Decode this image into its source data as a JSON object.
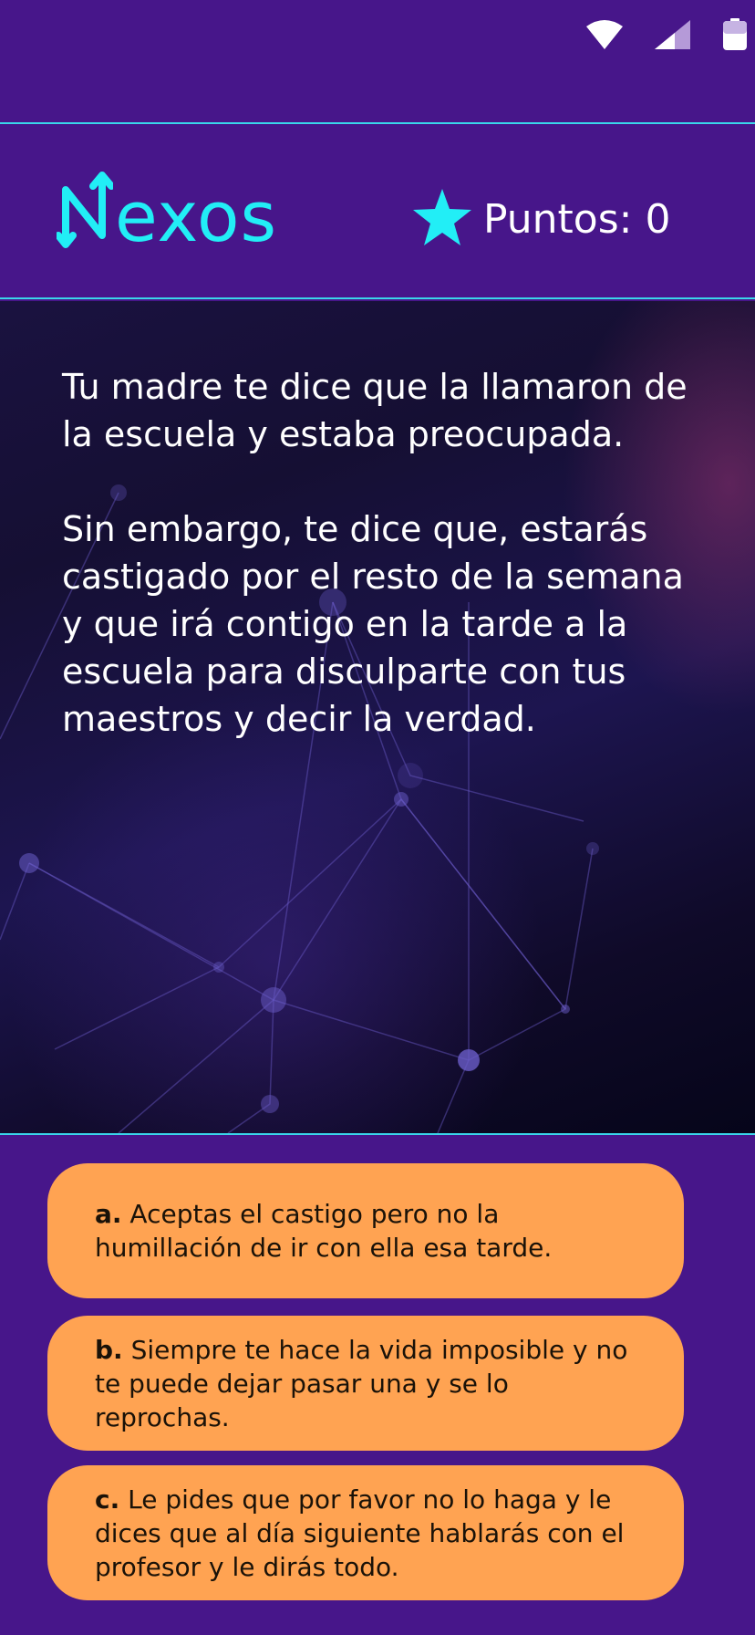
{
  "status_bar": {
    "icons": [
      "wifi-icon",
      "cell-signal-icon",
      "battery-icon"
    ]
  },
  "header": {
    "logo_text": "exos",
    "logo_letter": "N",
    "score_label": "Puntos: 0",
    "score_icon": "star-icon"
  },
  "story": {
    "paragraphs": [
      "Tu madre te dice que la llamaron de la escuela y estaba preocupada.",
      "Sin embargo, te dice que, estarás castigado por el resto de la semana y que irá contigo en la tarde a la escuela para disculparte con tus maestros y decir la verdad."
    ]
  },
  "options": [
    {
      "letter": "a.",
      "text": " Aceptas el castigo pero no la humillación de ir con ella esa tarde."
    },
    {
      "letter": "b.",
      "text": " Siempre te hace la vida imposible y no te puede dejar pasar una y se lo reprochas."
    },
    {
      "letter": "c.",
      "text": " Le pides que por favor no lo haga y le dices que al día siguiente hablarás con el profesor y le dirás todo."
    }
  ],
  "colors": {
    "background": "#47168a",
    "accent_cyan": "#22eef6",
    "option_fill": "#ffa352"
  }
}
